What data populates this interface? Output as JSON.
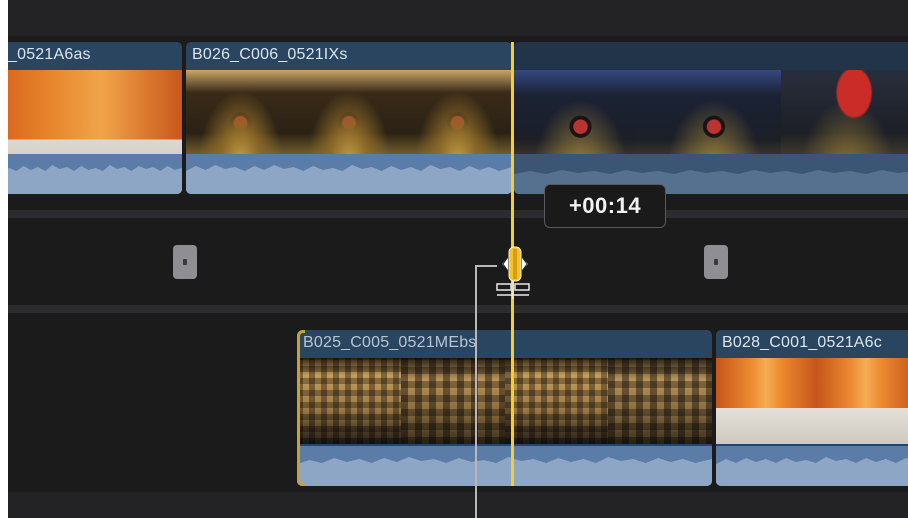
{
  "timeline": {
    "upper_track": {
      "clips": [
        {
          "name": "_0521A6as"
        },
        {
          "name": "B026_C006_0521IXs"
        },
        {
          "name": ""
        }
      ]
    },
    "lower_track": {
      "clips": [
        {
          "name": "B025_C005_0521MEbs"
        },
        {
          "name": "B028_C001_0521A6c"
        }
      ]
    },
    "trim_tooltip": "+00:14",
    "icons": {
      "trim_handle": "ripple-trim-icon",
      "pointer": "trim-pointer-icon",
      "markers": [
        "gap-marker-icon",
        "gap-marker-icon"
      ]
    },
    "colors": {
      "playhead": "#f7cf2a",
      "clip_header": "#2a4560",
      "audio_wave": "#5b7ca6",
      "marker": "#8e8e93",
      "background": "#1b1b1c"
    }
  }
}
